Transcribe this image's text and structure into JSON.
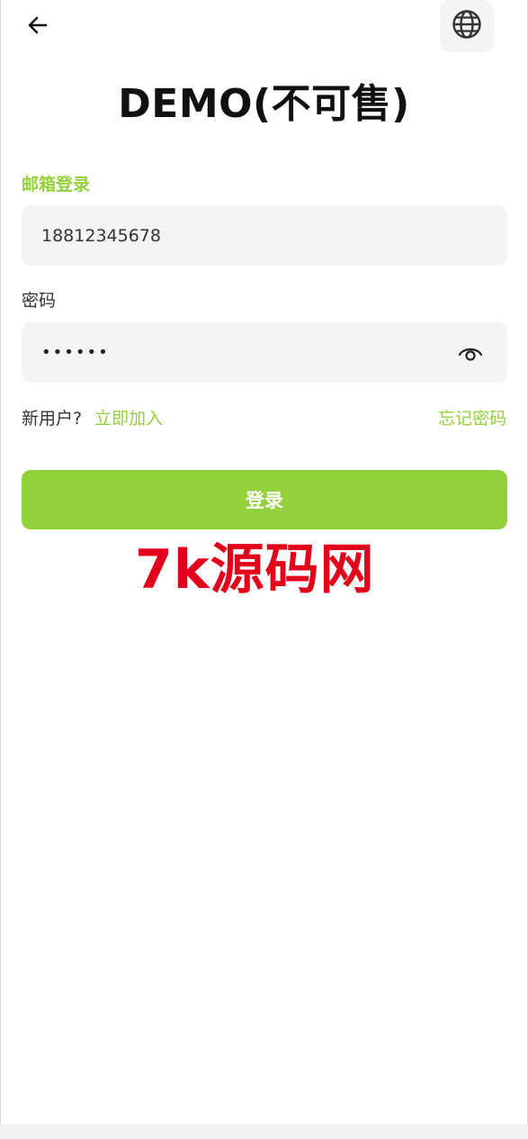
{
  "header": {
    "back_icon": "arrow-left-icon",
    "language_icon": "globe-icon"
  },
  "page": {
    "title": "DEMO(不可售)"
  },
  "login_form": {
    "section_label": "邮箱登录",
    "account_value": "18812345678",
    "password_label": "密码",
    "password_mask": "••••••",
    "eye_icon": "eye-icon"
  },
  "links": {
    "new_user_prompt": "新用户?",
    "join_link": "立即加入",
    "forgot_link": "忘记密码"
  },
  "actions": {
    "login_label": "登录"
  },
  "watermark": {
    "text": "7k源码网"
  },
  "colors": {
    "accent": "#93d13c",
    "field_bg": "#f4f4f4",
    "watermark": "#e2001a",
    "text": "#333333"
  }
}
